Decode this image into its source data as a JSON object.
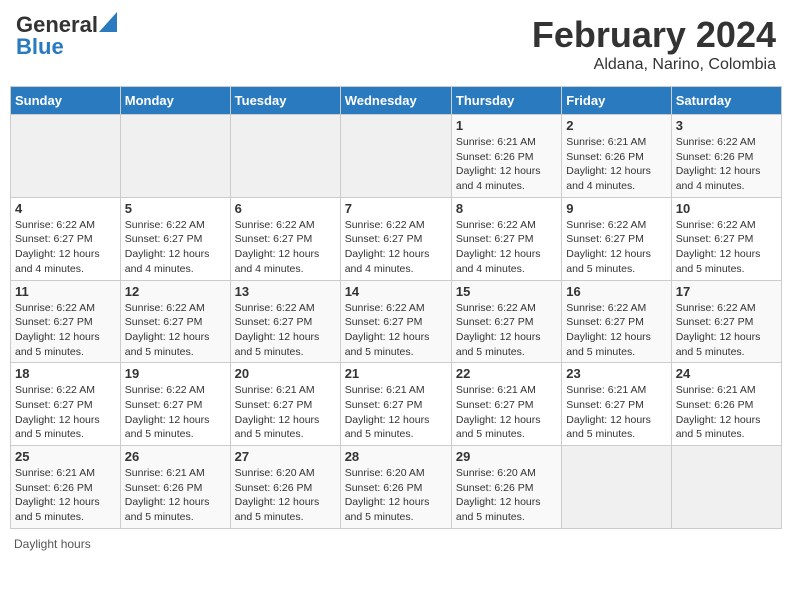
{
  "header": {
    "logo_general": "General",
    "logo_blue": "Blue",
    "main_title": "February 2024",
    "sub_title": "Aldana, Narino, Colombia"
  },
  "calendar": {
    "days_of_week": [
      "Sunday",
      "Monday",
      "Tuesday",
      "Wednesday",
      "Thursday",
      "Friday",
      "Saturday"
    ],
    "weeks": [
      [
        {
          "day": "",
          "detail": ""
        },
        {
          "day": "",
          "detail": ""
        },
        {
          "day": "",
          "detail": ""
        },
        {
          "day": "",
          "detail": ""
        },
        {
          "day": "1",
          "detail": "Sunrise: 6:21 AM\nSunset: 6:26 PM\nDaylight: 12 hours and 4 minutes."
        },
        {
          "day": "2",
          "detail": "Sunrise: 6:21 AM\nSunset: 6:26 PM\nDaylight: 12 hours and 4 minutes."
        },
        {
          "day": "3",
          "detail": "Sunrise: 6:22 AM\nSunset: 6:26 PM\nDaylight: 12 hours and 4 minutes."
        }
      ],
      [
        {
          "day": "4",
          "detail": "Sunrise: 6:22 AM\nSunset: 6:27 PM\nDaylight: 12 hours and 4 minutes."
        },
        {
          "day": "5",
          "detail": "Sunrise: 6:22 AM\nSunset: 6:27 PM\nDaylight: 12 hours and 4 minutes."
        },
        {
          "day": "6",
          "detail": "Sunrise: 6:22 AM\nSunset: 6:27 PM\nDaylight: 12 hours and 4 minutes."
        },
        {
          "day": "7",
          "detail": "Sunrise: 6:22 AM\nSunset: 6:27 PM\nDaylight: 12 hours and 4 minutes."
        },
        {
          "day": "8",
          "detail": "Sunrise: 6:22 AM\nSunset: 6:27 PM\nDaylight: 12 hours and 4 minutes."
        },
        {
          "day": "9",
          "detail": "Sunrise: 6:22 AM\nSunset: 6:27 PM\nDaylight: 12 hours and 5 minutes."
        },
        {
          "day": "10",
          "detail": "Sunrise: 6:22 AM\nSunset: 6:27 PM\nDaylight: 12 hours and 5 minutes."
        }
      ],
      [
        {
          "day": "11",
          "detail": "Sunrise: 6:22 AM\nSunset: 6:27 PM\nDaylight: 12 hours and 5 minutes."
        },
        {
          "day": "12",
          "detail": "Sunrise: 6:22 AM\nSunset: 6:27 PM\nDaylight: 12 hours and 5 minutes."
        },
        {
          "day": "13",
          "detail": "Sunrise: 6:22 AM\nSunset: 6:27 PM\nDaylight: 12 hours and 5 minutes."
        },
        {
          "day": "14",
          "detail": "Sunrise: 6:22 AM\nSunset: 6:27 PM\nDaylight: 12 hours and 5 minutes."
        },
        {
          "day": "15",
          "detail": "Sunrise: 6:22 AM\nSunset: 6:27 PM\nDaylight: 12 hours and 5 minutes."
        },
        {
          "day": "16",
          "detail": "Sunrise: 6:22 AM\nSunset: 6:27 PM\nDaylight: 12 hours and 5 minutes."
        },
        {
          "day": "17",
          "detail": "Sunrise: 6:22 AM\nSunset: 6:27 PM\nDaylight: 12 hours and 5 minutes."
        }
      ],
      [
        {
          "day": "18",
          "detail": "Sunrise: 6:22 AM\nSunset: 6:27 PM\nDaylight: 12 hours and 5 minutes."
        },
        {
          "day": "19",
          "detail": "Sunrise: 6:22 AM\nSunset: 6:27 PM\nDaylight: 12 hours and 5 minutes."
        },
        {
          "day": "20",
          "detail": "Sunrise: 6:21 AM\nSunset: 6:27 PM\nDaylight: 12 hours and 5 minutes."
        },
        {
          "day": "21",
          "detail": "Sunrise: 6:21 AM\nSunset: 6:27 PM\nDaylight: 12 hours and 5 minutes."
        },
        {
          "day": "22",
          "detail": "Sunrise: 6:21 AM\nSunset: 6:27 PM\nDaylight: 12 hours and 5 minutes."
        },
        {
          "day": "23",
          "detail": "Sunrise: 6:21 AM\nSunset: 6:27 PM\nDaylight: 12 hours and 5 minutes."
        },
        {
          "day": "24",
          "detail": "Sunrise: 6:21 AM\nSunset: 6:26 PM\nDaylight: 12 hours and 5 minutes."
        }
      ],
      [
        {
          "day": "25",
          "detail": "Sunrise: 6:21 AM\nSunset: 6:26 PM\nDaylight: 12 hours and 5 minutes."
        },
        {
          "day": "26",
          "detail": "Sunrise: 6:21 AM\nSunset: 6:26 PM\nDaylight: 12 hours and 5 minutes."
        },
        {
          "day": "27",
          "detail": "Sunrise: 6:20 AM\nSunset: 6:26 PM\nDaylight: 12 hours and 5 minutes."
        },
        {
          "day": "28",
          "detail": "Sunrise: 6:20 AM\nSunset: 6:26 PM\nDaylight: 12 hours and 5 minutes."
        },
        {
          "day": "29",
          "detail": "Sunrise: 6:20 AM\nSunset: 6:26 PM\nDaylight: 12 hours and 5 minutes."
        },
        {
          "day": "",
          "detail": ""
        },
        {
          "day": "",
          "detail": ""
        }
      ]
    ]
  },
  "footer": {
    "note": "Daylight hours"
  }
}
